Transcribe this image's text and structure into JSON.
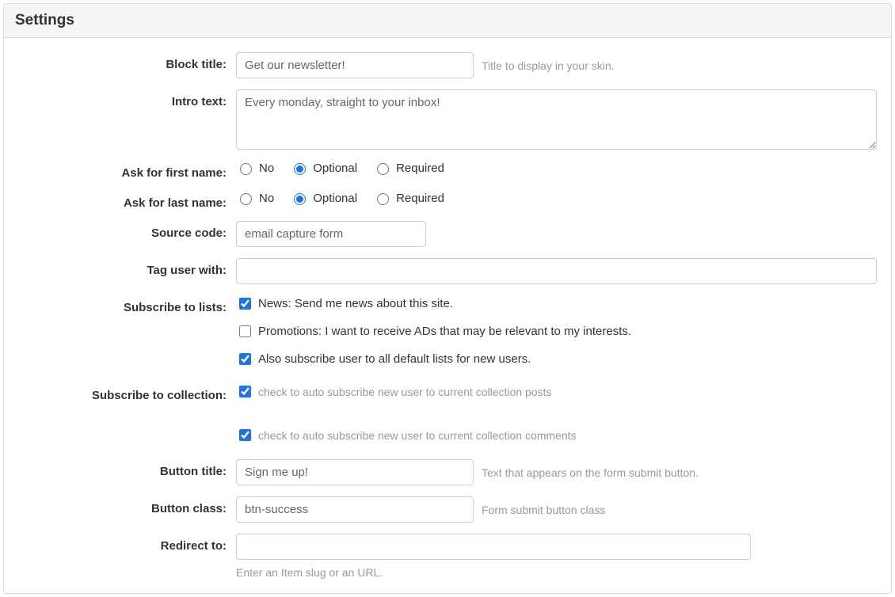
{
  "panel": {
    "title": "Settings"
  },
  "labels": {
    "block_title": "Block title:",
    "intro_text": "Intro text:",
    "ask_first_name": "Ask for first name:",
    "ask_last_name": "Ask for last name:",
    "source_code": "Source code:",
    "tag_user_with": "Tag user with:",
    "subscribe_to_lists": "Subscribe to lists:",
    "subscribe_to_collection": "Subscribe to collection:",
    "button_title": "Button title:",
    "button_class": "Button class:",
    "redirect_to": "Redirect to:"
  },
  "values": {
    "block_title": "Get our newsletter!",
    "intro_text": "Every monday, straight to your inbox!",
    "source_code": "email capture form",
    "tag_user_with": "",
    "button_title": "Sign me up!",
    "button_class": "btn-success",
    "redirect_to": ""
  },
  "hints": {
    "block_title": "Title to display in your skin.",
    "button_title": "Text that appears on the form submit button.",
    "button_class": "Form submit button class",
    "redirect_to": "Enter an Item slug or an URL."
  },
  "radio_options": {
    "no": "No",
    "optional": "Optional",
    "required": "Required"
  },
  "radio_state": {
    "first_name": "optional",
    "last_name": "optional"
  },
  "lists": {
    "news": {
      "label": "News: Send me news about this site.",
      "checked": true
    },
    "promotions": {
      "label": "Promotions: I want to receive ADs that may be relevant to my interests.",
      "checked": false
    },
    "defaults": {
      "label": "Also subscribe user to all default lists for new users.",
      "checked": true
    }
  },
  "collection": {
    "posts": {
      "label": "check to auto subscribe new user to current collection posts",
      "checked": true
    },
    "comments": {
      "label": "check to auto subscribe new user to current collection comments",
      "checked": true
    }
  }
}
